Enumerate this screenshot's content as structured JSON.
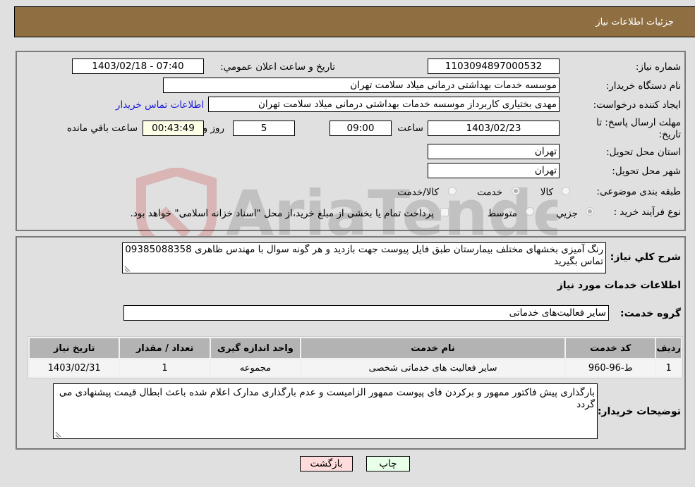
{
  "header": {
    "title": "جزئیات اطلاعات نیاز"
  },
  "fields": {
    "need_number_label": "شماره نیاز:",
    "need_number": "1103094897000532",
    "announce_label": "تاریخ و ساعت اعلان عمومي:",
    "announce_value": "1403/02/18 - 07:40",
    "buyer_org_label": "نام دستگاه خریدار:",
    "buyer_org": "موسسه خدمات بهداشتی درمانی میلاد سلامت تهران",
    "creator_label": "ایجاد کننده درخواست:",
    "creator": "مهدی بختیاری کاربرداز موسسه خدمات بهداشتی درمانی میلاد سلامت تهران",
    "contact_link": "اطلاعات تماس خریدار",
    "deadline_label_line1": "مهلت ارسال پاسخ: تا",
    "deadline_label_line2": "تاریخ:",
    "deadline_date": "1403/02/23",
    "time_label": "ساعت",
    "deadline_time": "09:00",
    "days_value": "5",
    "days_label": "روز و",
    "remaining_time": "00:43:49",
    "remaining_label": "ساعت باقي مانده",
    "province_label": "استان محل تحویل:",
    "province": "تهران",
    "city_label": "شهر محل تحویل:",
    "city": "تهران",
    "category_label": "طبقه بندی موضوعی:",
    "category_options": [
      {
        "label": "کالا",
        "selected": false
      },
      {
        "label": "خدمت",
        "selected": true
      },
      {
        "label": "کالا/خدمت",
        "selected": false
      }
    ],
    "purchase_type_label": "نوع فرآیند خرید :",
    "purchase_type_options": [
      {
        "label": "جزیي",
        "selected": true
      },
      {
        "label": "متوسط",
        "selected": false
      }
    ],
    "treasury_checkbox_checked": false,
    "treasury_text": "پرداخت تمام یا بخشی از مبلغ خرید،از محل \"اسناد خزانه اسلامی\" خواهد بود."
  },
  "description": {
    "label": "شرح كلي نياز:",
    "text": "رنگ آمیزی بخشهای مختلف بیمارستان طبق فایل پیوست جهت بازدید و هر گونه سوال با مهندس ظاهری 09385088358 تماس بگیرید"
  },
  "services": {
    "section_title": "اطلاعات خدمات مورد نیاز",
    "group_label": "گروه خدمت:",
    "group_value": "سایر فعالیت‌های خدماتی",
    "columns": [
      "ردیف",
      "کد خدمت",
      "نام خدمت",
      "واحد اندازه گیری",
      "تعداد / مقدار",
      "تاریخ نیاز"
    ],
    "rows": [
      {
        "row": "1",
        "code": "ط-96-960",
        "name": "سایر فعالیت های خدماتی شخصی",
        "unit": "مجموعه",
        "qty": "1",
        "date": "1403/02/31"
      }
    ]
  },
  "buyer_notes": {
    "label": "توضیحات خریدار:",
    "text": "بارگذاری پیش فاکتور ممهور و برکردن فای پیوست ممهور الزامیست و عدم بارگذاری مدارک اعلام شده باعث ابطال قیمت پیشنهادی می گردد"
  },
  "buttons": {
    "print": "چاپ",
    "back": "بازگشت"
  },
  "watermark": {
    "text": "AriaTender.neT"
  },
  "colors": {
    "header_bg": "#8f6f42",
    "link": "#1a1adb",
    "back_btn": "#ffdcdc",
    "print_btn": "#e8ffe8",
    "table_header": "#b3b3b3"
  }
}
